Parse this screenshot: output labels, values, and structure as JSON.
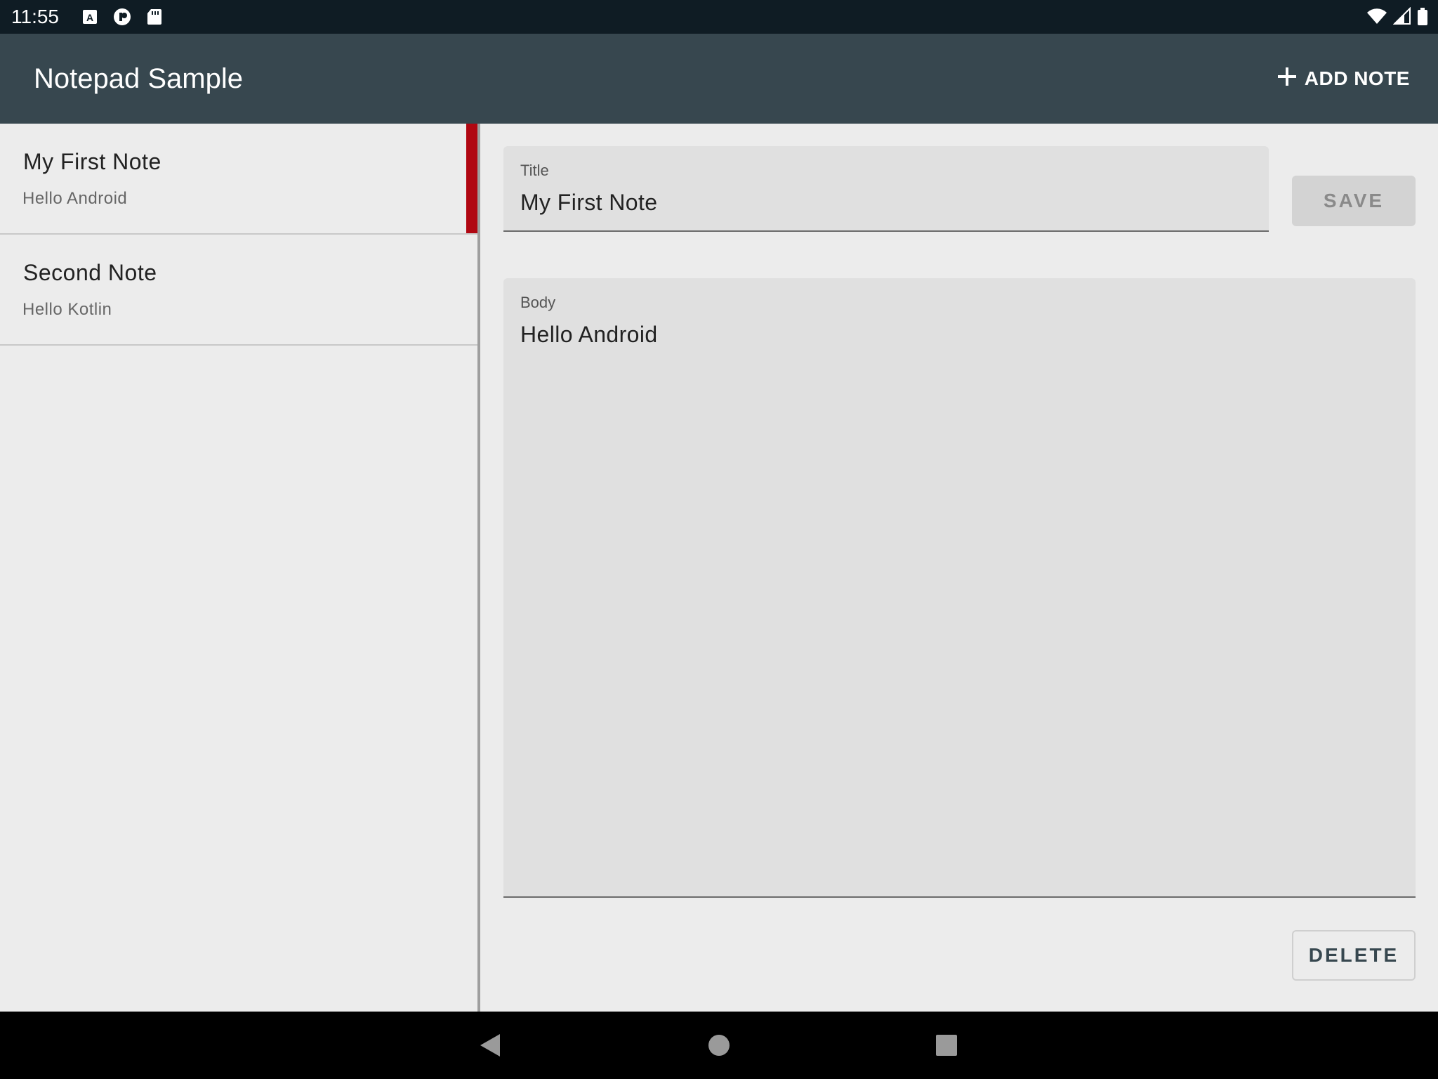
{
  "status_bar": {
    "time": "11:55",
    "left_icons": [
      "a-notification-icon",
      "p-notification-icon",
      "sd-card-icon"
    ],
    "right_icons": [
      "wifi-icon",
      "cell-signal-icon",
      "battery-icon"
    ]
  },
  "app_bar": {
    "title": "Notepad Sample",
    "add_note_label": "ADD NOTE",
    "add_icon": "plus-icon",
    "background": "#37474f"
  },
  "notes": [
    {
      "title": "My First Note",
      "body": "Hello Android",
      "selected": true
    },
    {
      "title": "Second Note",
      "body": "Hello Kotlin",
      "selected": false
    }
  ],
  "selection_color": "#b00712",
  "editor": {
    "title_label": "Title",
    "title_value": "My First Note",
    "body_label": "Body",
    "body_value": "Hello Android",
    "save_label": "SAVE",
    "delete_label": "DELETE"
  },
  "nav_bar": {
    "icons": [
      "back-icon",
      "home-icon",
      "recents-icon"
    ]
  }
}
